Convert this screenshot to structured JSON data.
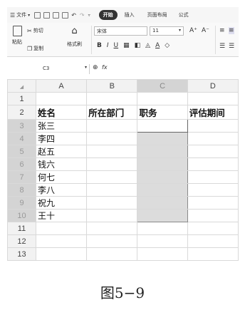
{
  "menubar": {
    "file_label": "文件",
    "tabs": [
      "开始",
      "插入",
      "页面布局",
      "公式"
    ],
    "active_tab": "开始"
  },
  "ribbon": {
    "paste_label": "粘贴",
    "cut_label": "剪切",
    "copy_label": "复制",
    "format_painter_label": "格式刷",
    "font_name": "宋体",
    "font_size": "11",
    "grow_font": "A⁺",
    "shrink_font": "A⁻",
    "bold": "B",
    "italic": "I",
    "underline": "U"
  },
  "formula_bar": {
    "cell_ref": "C3",
    "fx_label": "fx",
    "value": ""
  },
  "sheet": {
    "columns": [
      "A",
      "B",
      "C",
      "D"
    ],
    "selected_column": "C",
    "selected_range": "C3:C10",
    "rows": [
      {
        "num": "1",
        "cells": [
          "",
          "",
          "",
          ""
        ]
      },
      {
        "num": "2",
        "cells": [
          "姓名",
          "所在部门",
          "职务",
          "评估期间"
        ]
      },
      {
        "num": "3",
        "cells": [
          "张三",
          "",
          "",
          ""
        ]
      },
      {
        "num": "4",
        "cells": [
          "李四",
          "",
          "",
          ""
        ]
      },
      {
        "num": "5",
        "cells": [
          "赵五",
          "",
          "",
          ""
        ]
      },
      {
        "num": "6",
        "cells": [
          "钱六",
          "",
          "",
          ""
        ]
      },
      {
        "num": "7",
        "cells": [
          "何七",
          "",
          "",
          ""
        ]
      },
      {
        "num": "8",
        "cells": [
          "李八",
          "",
          "",
          ""
        ]
      },
      {
        "num": "9",
        "cells": [
          "祝九",
          "",
          "",
          ""
        ]
      },
      {
        "num": "10",
        "cells": [
          "王十",
          "",
          "",
          ""
        ]
      },
      {
        "num": "11",
        "cells": [
          "",
          "",
          "",
          ""
        ]
      },
      {
        "num": "12",
        "cells": [
          "",
          "",
          "",
          ""
        ]
      },
      {
        "num": "13",
        "cells": [
          "",
          "",
          "",
          ""
        ]
      }
    ]
  },
  "caption": "图5−9"
}
